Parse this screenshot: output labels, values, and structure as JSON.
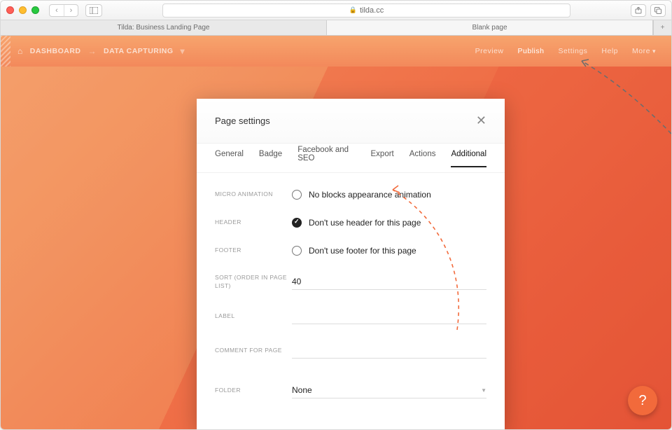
{
  "browser": {
    "address": "tilda.cc",
    "tabs": [
      "Tilda: Business Landing Page",
      "Blank page"
    ],
    "active_tab_index": 1
  },
  "topnav": {
    "crumb_home": "DASHBOARD",
    "crumb_page": "DATA CAPTURING",
    "right": {
      "preview": "Preview",
      "publish": "Publish",
      "settings": "Settings",
      "help": "Help",
      "more": "More"
    }
  },
  "modal": {
    "title": "Page settings",
    "tabs": [
      "General",
      "Badge",
      "Facebook and SEO",
      "Export",
      "Actions",
      "Additional"
    ],
    "active_tab_index": 5,
    "fields": {
      "micro_animation": {
        "label": "MICRO ANIMATION",
        "option": "No blocks appearance animation",
        "checked": false
      },
      "header": {
        "label": "HEADER",
        "option": "Don't use header for this page",
        "checked": true
      },
      "footer": {
        "label": "FOOTER",
        "option": "Don't use footer for this page",
        "checked": false
      },
      "sort": {
        "label": "SORT (ORDER IN PAGE LIST)",
        "value": "40"
      },
      "label_field": {
        "label": "LABEL",
        "value": ""
      },
      "comment": {
        "label": "COMMENT FOR PAGE",
        "value": ""
      },
      "folder": {
        "label": "FOLDER",
        "value": "None"
      }
    }
  },
  "fab": {
    "glyph": "?"
  },
  "colors": {
    "accent": "#f26a3b"
  }
}
